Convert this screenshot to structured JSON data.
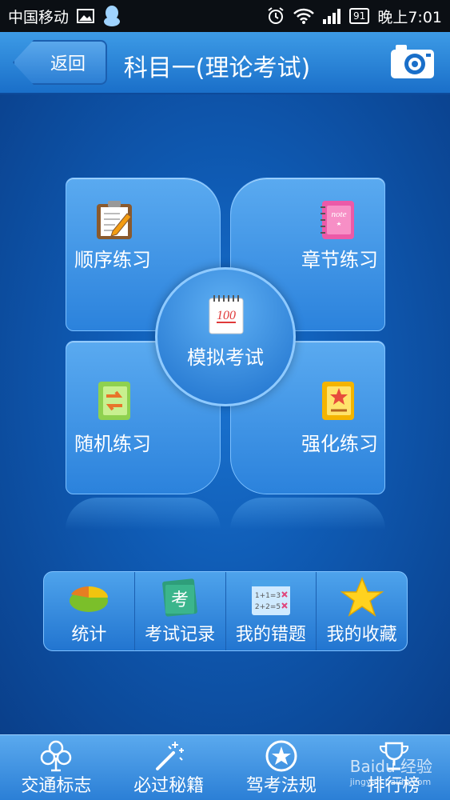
{
  "status_bar": {
    "carrier": "中国移动",
    "battery": "91",
    "time": "晚上7:01"
  },
  "header": {
    "back_label": "返回",
    "title": "科目一(理论考试)"
  },
  "main_menu": {
    "sequential": "顺序练习",
    "chapter": "章节练习",
    "random": "随机练习",
    "intensive": "强化练习",
    "mock_exam": "模拟考试"
  },
  "tools": [
    {
      "label": "统计"
    },
    {
      "label": "考试记录"
    },
    {
      "label": "我的错题"
    },
    {
      "label": "我的收藏"
    }
  ],
  "bottom_nav": [
    {
      "label": "交通标志"
    },
    {
      "label": "必过秘籍"
    },
    {
      "label": "驾考法规"
    },
    {
      "label": "排行榜"
    }
  ],
  "watermark": {
    "text": "Baidu 经验",
    "sub": "jingyan.baidu.com"
  }
}
